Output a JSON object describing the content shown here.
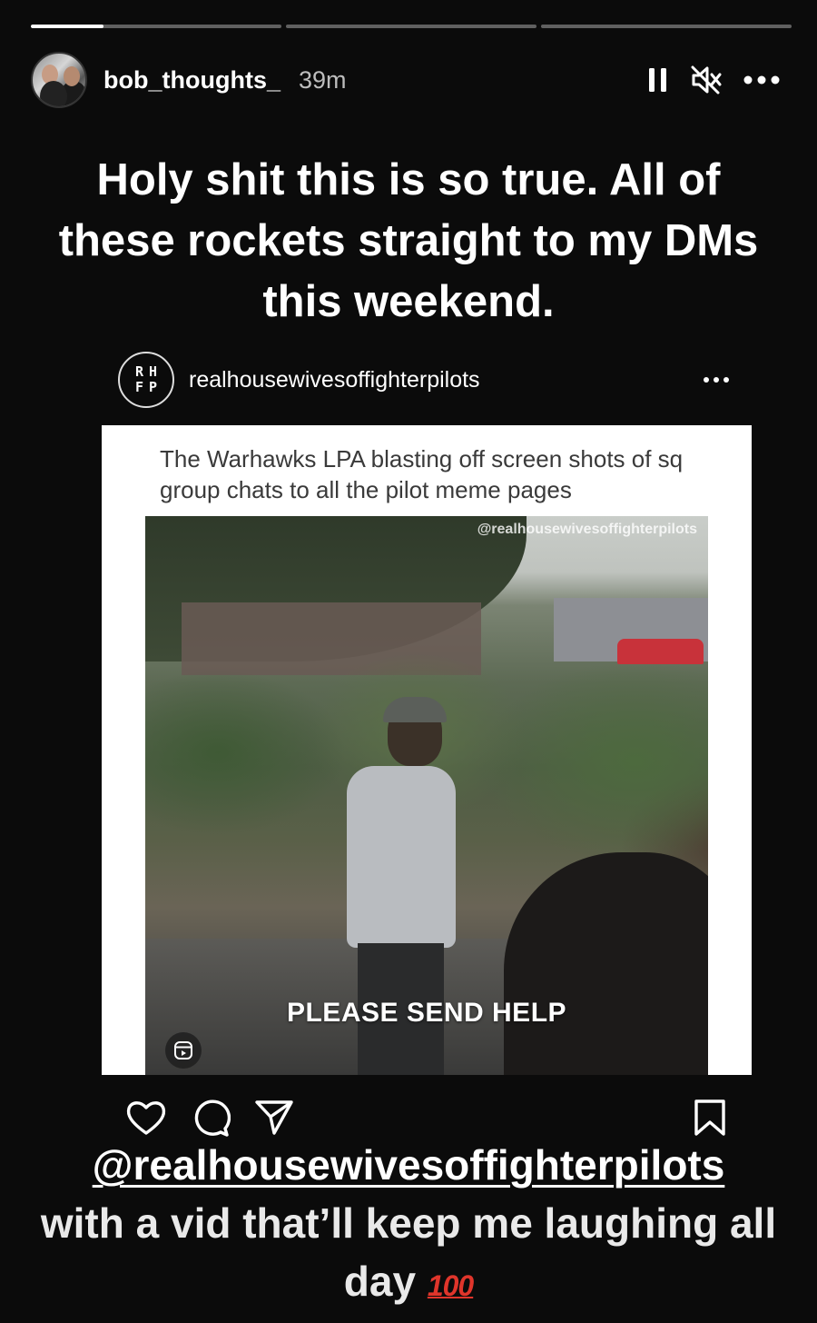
{
  "progress": {
    "segments": [
      {
        "fill": 0.29
      },
      {
        "fill": 0
      },
      {
        "fill": 0
      }
    ]
  },
  "header": {
    "username": "bob_thoughts_",
    "time": "39m",
    "icons": [
      "pause-icon",
      "mute-icon",
      "more-icon"
    ]
  },
  "caption_top": "Holy shit this is so true.  All of these rockets straight to my DMs this weekend.",
  "post": {
    "avatar_letters": [
      "R",
      "H",
      "F",
      "P"
    ],
    "handle": "realhousewivesoffighterpilots",
    "text": "The Warhawks LPA blasting off screen shots of sq group chats to all the pilot meme pages",
    "watermark": "@realhousewivesoffighterpilots",
    "overlay_text": "PLEASE SEND HELP"
  },
  "actions": {
    "left": [
      "heart-icon",
      "comment-icon",
      "share-icon"
    ],
    "right": [
      "bookmark-icon"
    ]
  },
  "caption_bottom": {
    "mention": "@realhousewivesoffighterpilots",
    "text": "with a vid that’ll keep me laughing all day",
    "emoji": "100"
  },
  "colors": {
    "background": "#0b0b0b",
    "card": "#ffffff",
    "hundred_red": "#e0352b"
  }
}
